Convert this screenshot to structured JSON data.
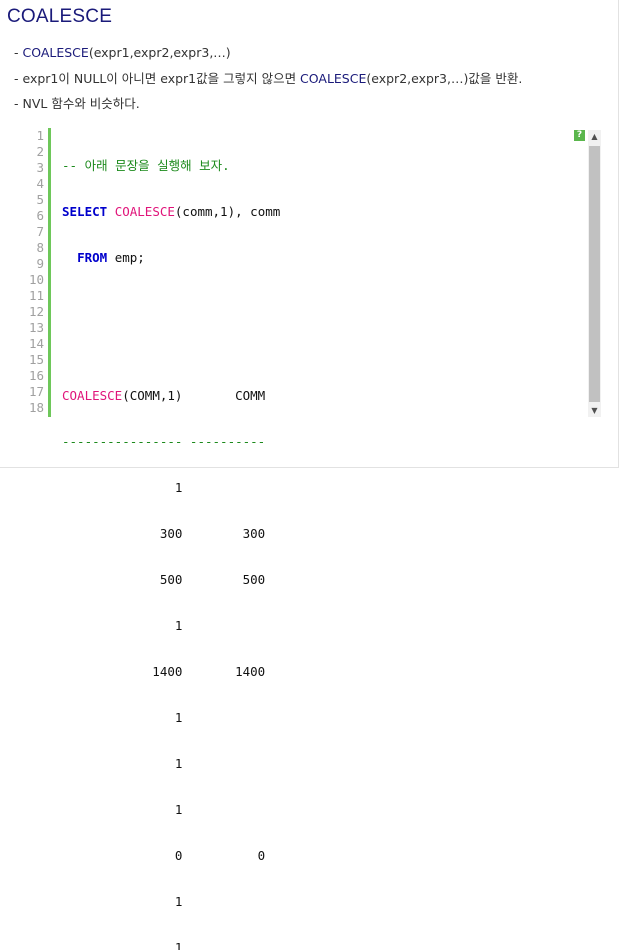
{
  "title": "COALESCE",
  "bullets": [
    {
      "prefix": "- ",
      "kw": "COALESCE",
      "rest": "(expr1,expr2,expr3,…)"
    },
    {
      "prefix": "- expr1이 NULL이 아니면 expr1값을 그렇지 않으면 ",
      "kw": "COALESCE",
      "rest": "(expr2,expr3,…)값을 반환."
    },
    {
      "prefix": "- NVL 함수와 비슷하다.",
      "kw": "",
      "rest": ""
    }
  ],
  "code": {
    "line_numbers": [
      "1",
      "2",
      "3",
      "4",
      "5",
      "6",
      "7",
      "8",
      "9",
      "10",
      "11",
      "12",
      "13",
      "14",
      "15",
      "16",
      "17",
      "18"
    ],
    "l1": "-- 아래 문장을 실행해 보자.",
    "l2_kw": "SELECT",
    "l2_fn": "COALESCE",
    "l2_rest": "(comm,1), comm",
    "l3_kw": "FROM",
    "l3_rest": " emp;",
    "l6_fn": "COALESCE",
    "l6_rest": "(COMM,1)       COMM",
    "l7": "---------------- ----------",
    "rows": [
      "               1",
      "             300        300",
      "             500        500",
      "               1",
      "            1400       1400",
      "               1",
      "               1",
      "               1",
      "               0          0",
      "               1",
      "               1"
    ]
  },
  "help_icon_label": "?"
}
